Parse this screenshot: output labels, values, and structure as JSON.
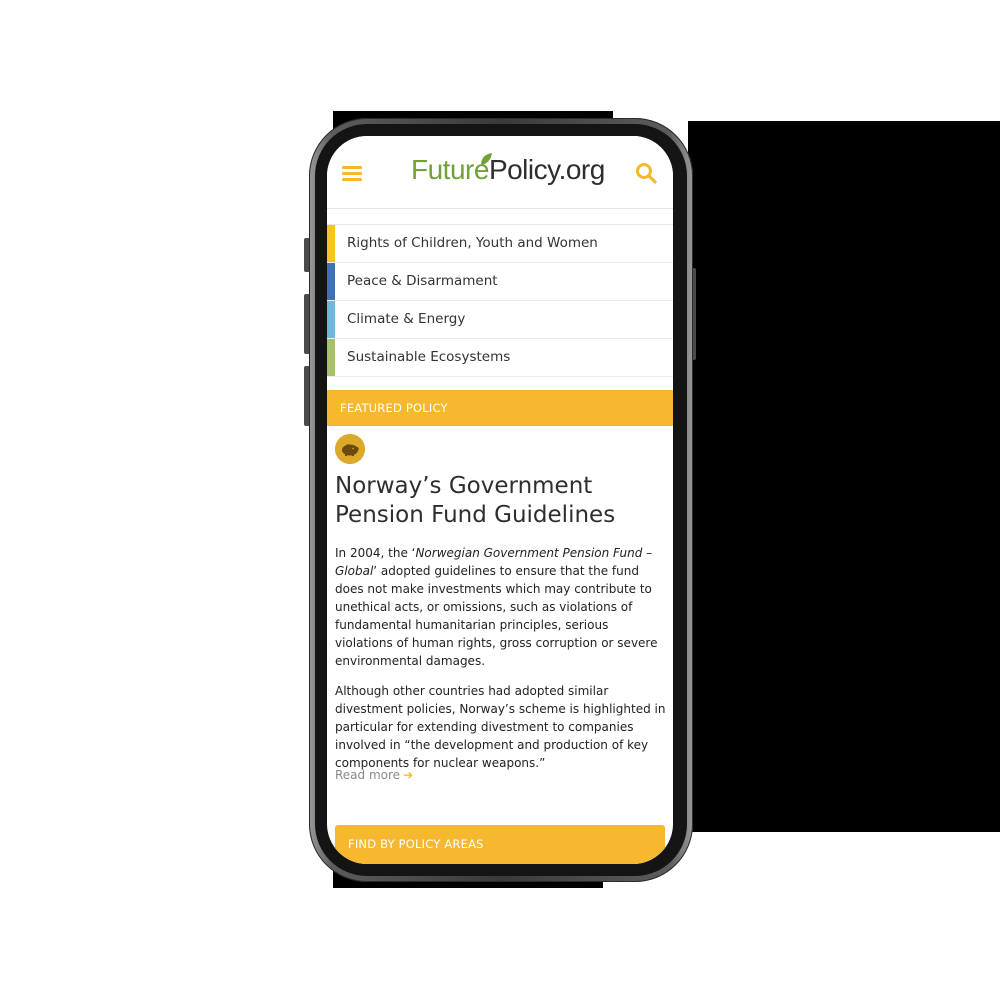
{
  "header": {
    "logo_part1": "Future",
    "logo_part2": "Policy",
    "logo_part3": ".org",
    "menu_icon": "hamburger-menu-icon",
    "search_icon": "search-icon"
  },
  "categories": [
    {
      "label": "Rights of Children, Youth and Women",
      "color": "#f5c518"
    },
    {
      "label": "Peace & Disarmament",
      "color": "#3f72b5"
    },
    {
      "label": "Climate & Energy",
      "color": "#6fb7de"
    },
    {
      "label": "Sustainable Ecosystems",
      "color": "#a7c16a"
    }
  ],
  "featured": {
    "band_label": "FEATURED POLICY",
    "icon": "piggy-bank-icon",
    "title": "Norway’s Government Pension Fund Guidelines",
    "p1_pre": "In 2004, the ‘",
    "p1_em": "Norwegian Government Pension Fund – Global",
    "p1_post": "’ adopted guidelines to ensure that the fund does not make investments which may contribute to unethical acts, or omissions, such as violations of fundamental humanitarian principles, serious violations of human rights, gross corruption or severe environmental damages.",
    "p2": "Although other countries had adopted similar divestment policies, Norway’s scheme  is highlighted in particular for extending divestment to companies involved in “the development and production of key components for nuclear weapons.”",
    "read_more": "Read more"
  },
  "find": {
    "band_label": "FIND BY POLICY AREAS"
  },
  "colors": {
    "accent": "#f5b82e",
    "logo_green": "#72a13a",
    "logo_dark": "#2e2e2e"
  }
}
